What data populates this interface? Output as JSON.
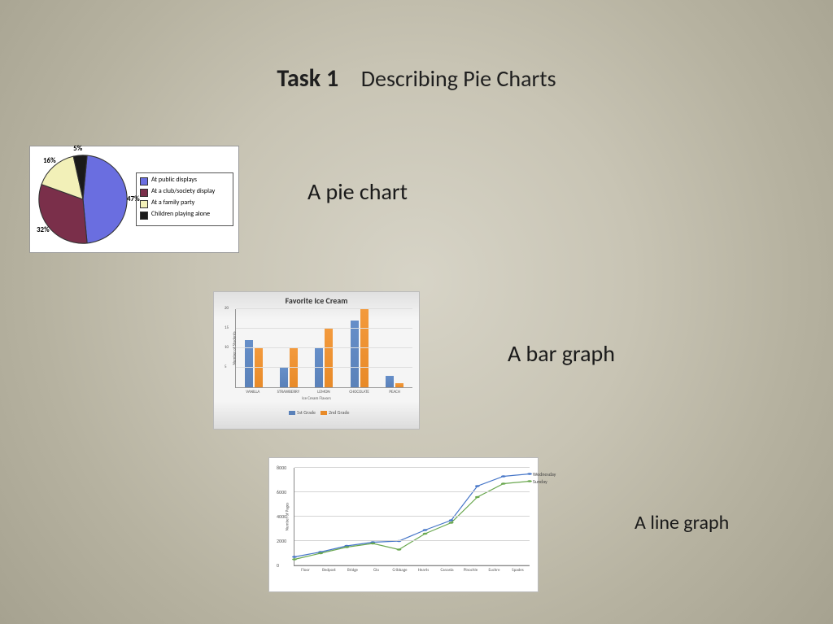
{
  "title": {
    "bold": "Task 1",
    "sub": "Describing Pie Charts"
  },
  "captions": {
    "pie": "A pie chart",
    "bar": "A bar graph",
    "line": "A line graph"
  },
  "chart_data": [
    {
      "type": "pie",
      "series": [
        {
          "name": "At public displays",
          "value": 47,
          "color": "#6a6ee0"
        },
        {
          "name": "At a club/society display",
          "value": 32,
          "color": "#7a2f4a"
        },
        {
          "name": "At a family party",
          "value": 16,
          "color": "#f2f0b8"
        },
        {
          "name": "Children playing alone",
          "value": 5,
          "color": "#1a1a1a"
        }
      ],
      "value_suffix": "%"
    },
    {
      "type": "bar",
      "title": "Favorite Ice Cream",
      "xlabel": "Ice Cream Flavors",
      "ylabel": "Number of Students",
      "categories": [
        "VANILLA",
        "STRAWBERRY",
        "LEMON",
        "CHOCOLATE",
        "PEACH"
      ],
      "series": [
        {
          "name": "1st Grade",
          "color": "#5a81b9",
          "values": [
            12,
            5,
            10,
            17,
            3
          ]
        },
        {
          "name": "2nd Grade",
          "color": "#e88a28",
          "values": [
            10,
            10,
            15,
            20,
            1
          ]
        }
      ],
      "ylim": [
        0,
        20
      ],
      "yticks": [
        5,
        10,
        15,
        20
      ]
    },
    {
      "type": "line",
      "ylabel": "Number of Pages",
      "categories": [
        "Floor",
        "Bedpost",
        "Bridge",
        "Glo",
        "Cribbage",
        "Hearts",
        "Canasta",
        "Pinochle",
        "Euchre",
        "Spades"
      ],
      "series": [
        {
          "name": "Wednesday",
          "color": "#4676c8",
          "values": [
            700,
            1100,
            1600,
            1900,
            2000,
            2900,
            3700,
            6500,
            7300,
            7500
          ]
        },
        {
          "name": "Sunday",
          "color": "#6aa84f",
          "values": [
            500,
            1000,
            1500,
            1800,
            1300,
            2600,
            3500,
            5600,
            6700,
            6900
          ]
        }
      ],
      "ylim": [
        0,
        8000
      ],
      "yticks": [
        0,
        2000,
        4000,
        6000,
        8000
      ]
    }
  ]
}
